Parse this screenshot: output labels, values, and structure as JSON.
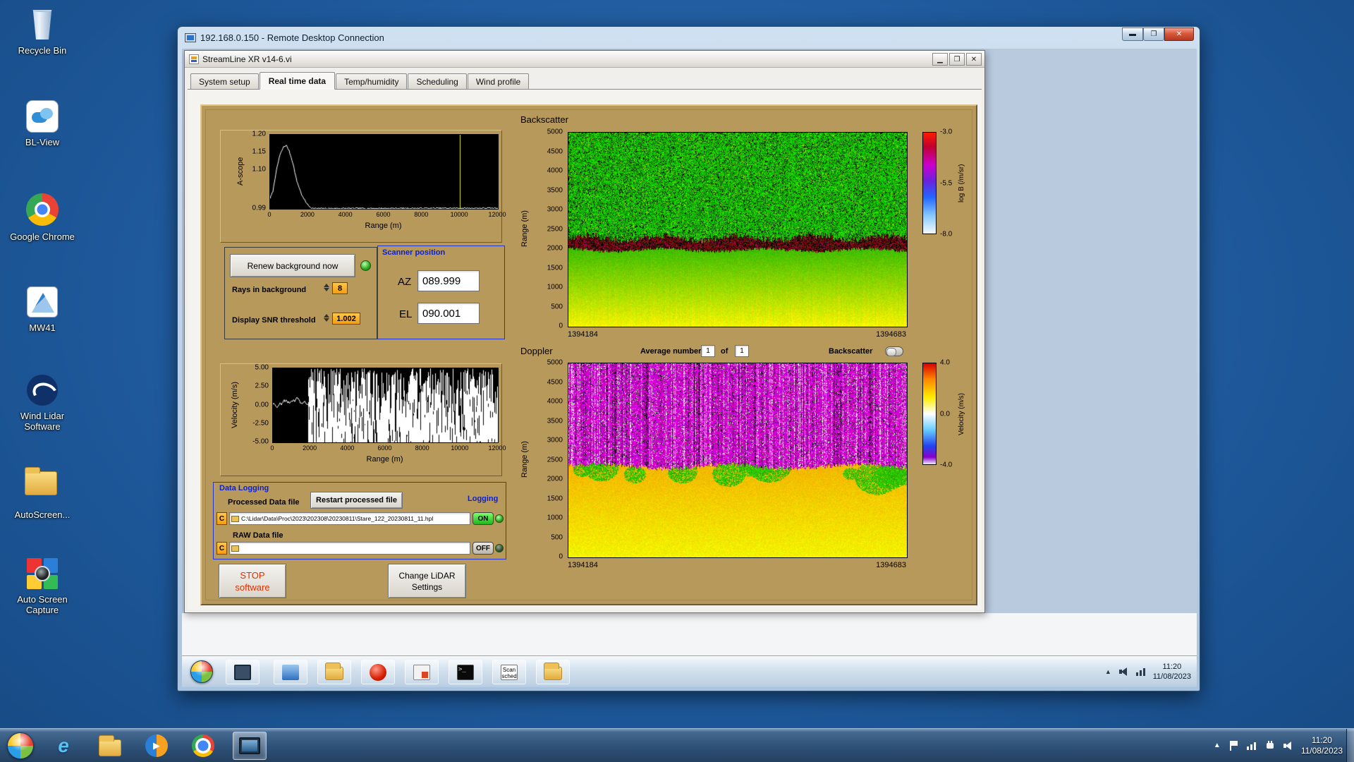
{
  "host": {
    "desktop_icons": [
      {
        "label": "Recycle Bin"
      },
      {
        "label": "BL-View"
      },
      {
        "label": "Google Chrome"
      },
      {
        "label": "MW41"
      },
      {
        "label": "Wind Lidar Software"
      },
      {
        "label": "AutoScreen..."
      },
      {
        "label": "Auto Screen Capture"
      }
    ],
    "taskbar": {
      "clock_time": "11:20",
      "clock_date": "11/08/2023"
    }
  },
  "rdp": {
    "title": "192.168.0.150 - Remote Desktop Connection"
  },
  "remote": {
    "taskbar": {
      "clock_time": "11:20",
      "clock_date": "11/08/2023",
      "scan_sched_line1": "Scan",
      "scan_sched_line2": "sched"
    }
  },
  "app": {
    "title": "StreamLine XR v14-6.vi",
    "tabs": [
      {
        "label": "System setup"
      },
      {
        "label": "Real time data"
      },
      {
        "label": "Temp/humidity"
      },
      {
        "label": "Scheduling"
      },
      {
        "label": "Wind profile"
      }
    ],
    "controls": {
      "renew_button": "Renew background now",
      "rays_label": "Rays in background",
      "rays_value": "8",
      "snr_label": "Display SNR threshold",
      "snr_value": "1.002",
      "scanner_title": "Scanner position",
      "az_label": "AZ",
      "az_value": "089.999",
      "el_label": "EL",
      "el_value": "090.001",
      "average_label": "Average number",
      "average_value": "1",
      "of_label": "of",
      "of_value": "1",
      "backscatter_toggle_label": "Backscatter"
    },
    "logging": {
      "group_title": "Data Logging",
      "processed_label": "Processed Data file",
      "restart_button": "Restart processed file",
      "logging_label": "Logging",
      "drive_letter": "C",
      "processed_path": "C:\\Lidar\\Data\\Proc\\2023\\202308\\20230811\\Stare_122_20230811_11.hpl",
      "on_label": "ON",
      "raw_label": "RAW Data file",
      "raw_path": "",
      "off_label": "OFF"
    },
    "buttons": {
      "stop_line1": "STOP",
      "stop_line2": "software",
      "change_line1": "Change LiDAR",
      "change_line2": "Settings"
    }
  },
  "chart_data": [
    {
      "id": "ascope",
      "type": "line",
      "ylabel": "A-scope",
      "xlabel": "Range (m)",
      "xlim": [
        0,
        12000
      ],
      "ylim": [
        0.99,
        1.2
      ],
      "yticks": [
        {
          "v": 1.2,
          "label": "1.20"
        },
        {
          "v": 1.15,
          "label": "1.15"
        },
        {
          "v": 1.1,
          "label": "1.10"
        },
        {
          "v": 0.99,
          "label": "0.99"
        }
      ],
      "xticks": [
        {
          "v": 0,
          "label": "0"
        },
        {
          "v": 2000,
          "label": "2000"
        },
        {
          "v": 4000,
          "label": "4000"
        },
        {
          "v": 6000,
          "label": "6000"
        },
        {
          "v": 8000,
          "label": "8000"
        },
        {
          "v": 10000,
          "label": "10000"
        },
        {
          "v": 12000,
          "label": "12000"
        }
      ],
      "cursor_x": 10000,
      "points": [
        [
          0,
          1.02
        ],
        [
          150,
          1.04
        ],
        [
          300,
          1.09
        ],
        [
          500,
          1.14
        ],
        [
          700,
          1.165
        ],
        [
          850,
          1.17
        ],
        [
          1000,
          1.155
        ],
        [
          1200,
          1.12
        ],
        [
          1400,
          1.07
        ],
        [
          1700,
          1.025
        ],
        [
          2000,
          1.0
        ],
        [
          2200,
          0.992
        ],
        [
          2400,
          0.991
        ],
        [
          12000,
          0.992
        ]
      ]
    },
    {
      "id": "velocity",
      "type": "line-noise",
      "ylabel": "Velocity (m/s)",
      "xlabel": "Range (m)",
      "xlim": [
        0,
        12000
      ],
      "ylim": [
        -5,
        5
      ],
      "yticks": [
        {
          "v": 5,
          "label": "5.00"
        },
        {
          "v": 2.5,
          "label": "2.50"
        },
        {
          "v": 0,
          "label": "0.00"
        },
        {
          "v": -2.5,
          "label": "-2.50"
        },
        {
          "v": -5,
          "label": "-5.00"
        }
      ],
      "xticks": [
        {
          "v": 0,
          "label": "0"
        },
        {
          "v": 2000,
          "label": "2000"
        },
        {
          "v": 4000,
          "label": "4000"
        },
        {
          "v": 6000,
          "label": "6000"
        },
        {
          "v": 8000,
          "label": "8000"
        },
        {
          "v": 10000,
          "label": "10000"
        },
        {
          "v": 12000,
          "label": "12000"
        }
      ],
      "signal_range_m": [
        0,
        1900
      ],
      "noise_range_m": [
        1900,
        12000
      ]
    },
    {
      "id": "backscatter",
      "type": "heatmap",
      "title": "Backscatter",
      "ylabel": "Range (m)",
      "ylim": [
        0,
        5000
      ],
      "yticks": [
        {
          "v": 5000,
          "label": "5000"
        },
        {
          "v": 4500,
          "label": "4500"
        },
        {
          "v": 4000,
          "label": "4000"
        },
        {
          "v": 3500,
          "label": "3500"
        },
        {
          "v": 3000,
          "label": "3000"
        },
        {
          "v": 2500,
          "label": "2500"
        },
        {
          "v": 2000,
          "label": "2000"
        },
        {
          "v": 1500,
          "label": "1500"
        },
        {
          "v": 1000,
          "label": "1000"
        },
        {
          "v": 500,
          "label": "500"
        },
        {
          "v": 0,
          "label": "0"
        }
      ],
      "x_start_label": "1394184",
      "x_end_label": "1394683",
      "colorbar": {
        "label": "log B (/m/sr)",
        "lim": [
          -8,
          -3
        ],
        "ticks": [
          {
            "v": -3,
            "label": "-3.0"
          },
          {
            "v": -5.5,
            "label": "-5.5"
          },
          {
            "v": -8,
            "label": "-8.0"
          }
        ]
      },
      "bands": {
        "noise_above_m": 2300,
        "aerosol_band_m": [
          1950,
          2300
        ]
      }
    },
    {
      "id": "doppler",
      "type": "heatmap",
      "title": "Doppler",
      "ylabel": "Range (m)",
      "ylim": [
        0,
        5000
      ],
      "yticks": [
        {
          "v": 5000,
          "label": "5000"
        },
        {
          "v": 4500,
          "label": "4500"
        },
        {
          "v": 4000,
          "label": "4000"
        },
        {
          "v": 3500,
          "label": "3500"
        },
        {
          "v": 3000,
          "label": "3000"
        },
        {
          "v": 2500,
          "label": "2500"
        },
        {
          "v": 2000,
          "label": "2000"
        },
        {
          "v": 1500,
          "label": "1500"
        },
        {
          "v": 1000,
          "label": "1000"
        },
        {
          "v": 500,
          "label": "500"
        },
        {
          "v": 0,
          "label": "0"
        }
      ],
      "x_start_label": "1394184",
      "x_end_label": "1394683",
      "colorbar": {
        "label": "Velocity (m/s)",
        "lim": [
          -4,
          4
        ],
        "ticks": [
          {
            "v": 4,
            "label": "4.0"
          },
          {
            "v": 0,
            "label": "0.0"
          },
          {
            "v": -4,
            "label": "-4.0"
          }
        ]
      },
      "bands": {
        "noise_above_m": 2350
      }
    }
  ]
}
